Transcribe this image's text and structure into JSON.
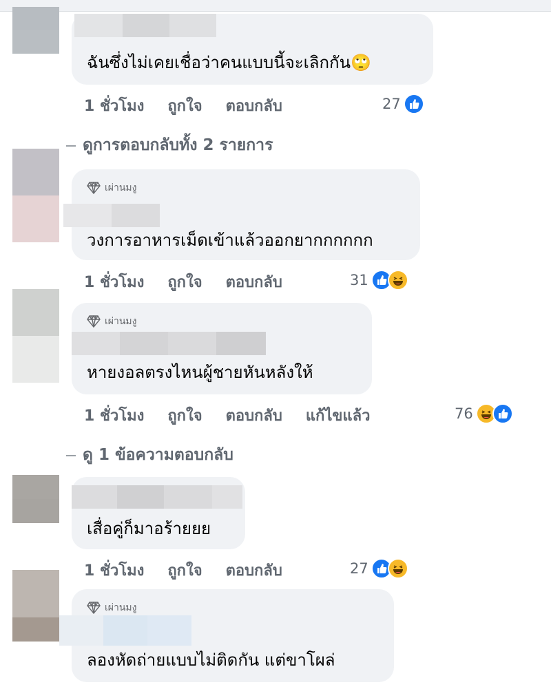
{
  "comments": [
    {
      "text": "ฉันซึ่งไม่เคยเชื่อว่าคนแบบนี้จะเลิกกัน🙄",
      "time": "1 ชั่วโมง",
      "like_label": "ถูกใจ",
      "reply_label": "ตอบกลับ",
      "reaction_count": "27",
      "reactions": [
        "like"
      ]
    },
    {
      "badge": "เผ่านมงู",
      "text": "วงการอาหารเม็ดเข้าแล้วออกยากกกกกก",
      "time": "1 ชั่วโมง",
      "like_label": "ถูกใจ",
      "reply_label": "ตอบกลับ",
      "reaction_count": "31",
      "reactions": [
        "like",
        "haha"
      ]
    },
    {
      "badge": "เผ่านมงู",
      "text": "หายงอลตรงไหนผู้ชายหันหลังให้",
      "time": "1 ชั่วโมง",
      "like_label": "ถูกใจ",
      "reply_label": "ตอบกลับ",
      "edited_label": "แก้ไขแล้ว",
      "reaction_count": "76",
      "reactions": [
        "haha",
        "like"
      ]
    },
    {
      "text": "เสื่อคู่ก็มาอร้ายยย",
      "time": "1 ชั่วโมง",
      "like_label": "ถูกใจ",
      "reply_label": "ตอบกลับ",
      "reaction_count": "27",
      "reactions": [
        "like",
        "haha"
      ]
    },
    {
      "badge": "เผ่านมงู",
      "text": "ลองหัดถ่ายแบบไม่ติดกัน แต่ขาโผล่"
    }
  ],
  "view_replies": [
    {
      "label": "ดูการตอบกลับทั้ง 2 รายการ"
    },
    {
      "label": "ดู 1 ข้อความตอบกลับ"
    }
  ],
  "colors": {
    "bubble": "#f0f2f5",
    "action_text": "#606770",
    "like": "#1877f2",
    "haha": "#f7b928"
  }
}
